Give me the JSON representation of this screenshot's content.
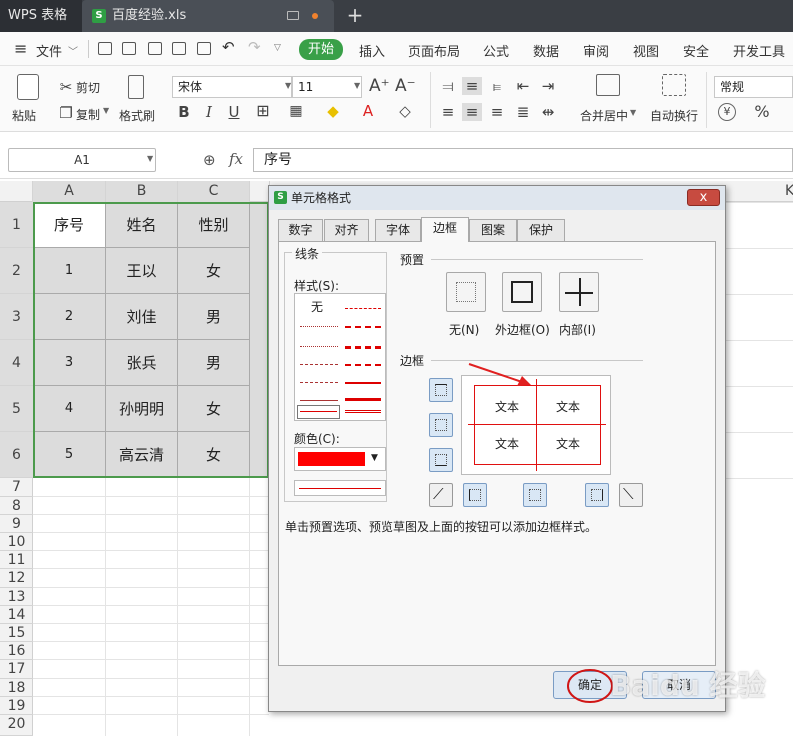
{
  "titlebar": {
    "app": "WPS 表格",
    "doc": "百度经验.xls",
    "new_tab": "+"
  },
  "menu": {
    "file": "文件",
    "tabs": [
      "开始",
      "插入",
      "页面布局",
      "公式",
      "数据",
      "审阅",
      "视图",
      "安全",
      "开发工具"
    ]
  },
  "ribbon": {
    "paste": "粘贴",
    "cut": "剪切",
    "copy": "复制",
    "format_painter": "格式刷",
    "font": "宋体",
    "size": "11",
    "merge": "合并居中",
    "wrap": "自动换行",
    "number_format": "常规",
    "currency": "¥",
    "percent": "%"
  },
  "formula_bar": {
    "namebox": "A1",
    "fx": "fx",
    "value": "序号"
  },
  "sheet": {
    "columns": [
      "A",
      "B",
      "C",
      "K"
    ],
    "rows": [
      "1",
      "2",
      "3",
      "4",
      "5",
      "6",
      "7",
      "8",
      "9",
      "10",
      "11",
      "12",
      "13",
      "14",
      "15",
      "16",
      "17",
      "18",
      "19",
      "20"
    ],
    "table": [
      [
        "序号",
        "姓名",
        "性别"
      ],
      [
        "1",
        "王以",
        "女"
      ],
      [
        "2",
        "刘佳",
        "男"
      ],
      [
        "3",
        "张兵",
        "男"
      ],
      [
        "4",
        "孙明明",
        "女"
      ],
      [
        "5",
        "高云清",
        "女"
      ]
    ]
  },
  "dialog": {
    "title": "单元格格式",
    "close": "x",
    "tabs": [
      "数字",
      "对齐",
      "字体",
      "边框",
      "图案",
      "保护"
    ],
    "active_tab": "边框",
    "line_group": "线条",
    "style_label": "样式(S):",
    "style_none": "无",
    "color_label": "颜色(C):",
    "color_value": "#ff0000",
    "preset_group": "预置",
    "presets": [
      "无(N)",
      "外边框(O)",
      "内部(I)"
    ],
    "border_group": "边框",
    "preview_text": [
      "文本",
      "文本",
      "文本",
      "文本"
    ],
    "hint": "单击预置选项、预览草图及上面的按钮可以添加边框样式。",
    "ok": "确定",
    "cancel": "取消"
  },
  "watermark": "Baidu 经验"
}
